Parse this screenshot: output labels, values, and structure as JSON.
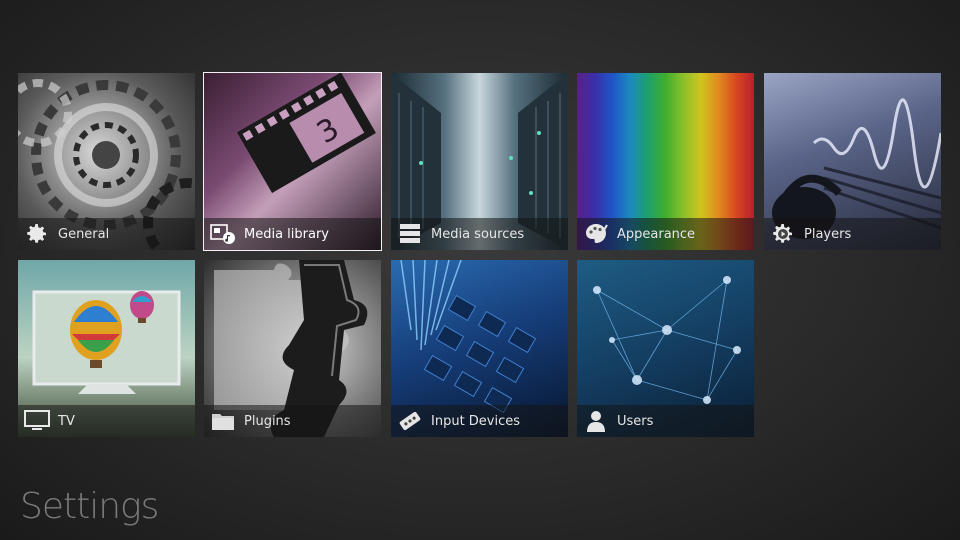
{
  "page": {
    "title": "Settings"
  },
  "tiles": [
    {
      "label": "General",
      "icon": "gear-icon"
    },
    {
      "label": "Media library",
      "icon": "media-library-icon"
    },
    {
      "label": "Media sources",
      "icon": "server-icon"
    },
    {
      "label": "Appearance",
      "icon": "palette-icon"
    },
    {
      "label": "Players",
      "icon": "gear-play-icon"
    },
    {
      "label": "TV",
      "icon": "monitor-icon"
    },
    {
      "label": "Plugins",
      "icon": "folder-icon"
    },
    {
      "label": "Input Devices",
      "icon": "remote-control-icon"
    },
    {
      "label": "Users",
      "icon": "user-icon"
    }
  ],
  "focused_tile": "Media library"
}
